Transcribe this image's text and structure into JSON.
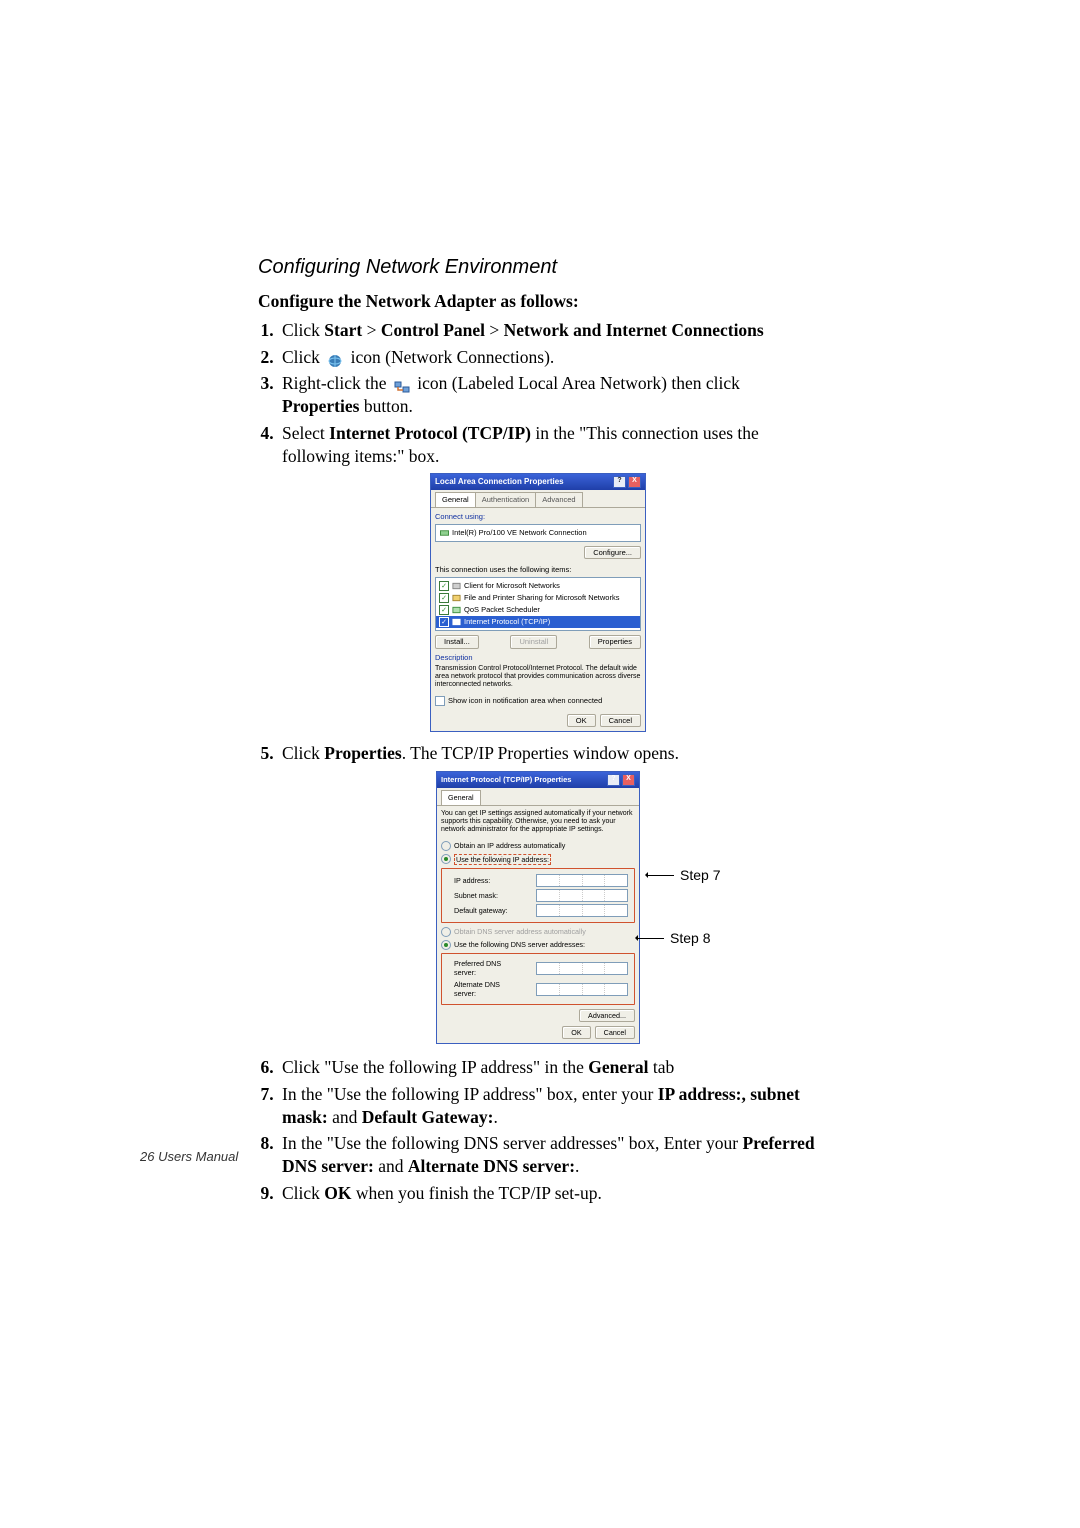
{
  "section_title": "Configuring Network Environment",
  "subtitle": "Configure the Network Adapter as follows:",
  "steps": {
    "s1a": "Click ",
    "s1b": "Start",
    "s1c": " > ",
    "s1d": "Control Panel",
    "s1e": " > ",
    "s1f": "Network and Internet Connections",
    "s2a": "Click ",
    "s2b": " icon (Network Connections).",
    "s3a": "Right-click the ",
    "s3b": " icon (Labeled Local Area Network) then click ",
    "s3c": "Properties",
    "s3d": " button.",
    "s4a": "Select ",
    "s4b": "Internet Protocol (TCP/IP)",
    "s4c": " in the \"This connection uses the following items:\" box.",
    "s5a": "Click ",
    "s5b": "Properties",
    "s5c": ". The TCP/IP Properties window opens.",
    "s6a": "Click \"Use the following IP address\" in the ",
    "s6b": "General",
    "s6c": " tab",
    "s7a": "In the \"Use the following IP address\" box, enter your ",
    "s7b": "IP address:, subnet mask:",
    "s7c": " and ",
    "s7d": "Default Gateway:",
    "s7e": ".",
    "s8a": "In the \"Use the following DNS server addresses\" box, Enter your ",
    "s8b": "Preferred DNS server:",
    "s8c": " and ",
    "s8d": "Alternate DNS server:",
    "s8e": ".",
    "s9a": "Click ",
    "s9b": "OK",
    "s9c": " when you finish the TCP/IP set-up."
  },
  "dialog1": {
    "title": "Local Area Connection Properties",
    "help": "?",
    "close": "X",
    "tabs": {
      "general": "General",
      "auth": "Authentication",
      "adv": "Advanced"
    },
    "connect_using": "Connect using:",
    "adapter": "Intel(R) Pro/100 VE Network Connection",
    "configure": "Configure...",
    "items_label": "This connection uses the following items:",
    "items": [
      "Client for Microsoft Networks",
      "File and Printer Sharing for Microsoft Networks",
      "QoS Packet Scheduler",
      "Internet Protocol (TCP/IP)"
    ],
    "install": "Install...",
    "uninstall": "Uninstall",
    "properties": "Properties",
    "desc_label": "Description",
    "desc": "Transmission Control Protocol/Internet Protocol. The default wide area network protocol that provides communication across diverse interconnected networks.",
    "show_icon": "Show icon in notification area when connected",
    "ok": "OK",
    "cancel": "Cancel"
  },
  "dialog2": {
    "title": "Internet Protocol (TCP/IP) Properties",
    "help": "?",
    "close": "X",
    "tab": "General",
    "help_text": "You can get IP settings assigned automatically if your network supports this capability. Otherwise, you need to ask your network administrator for the appropriate IP settings.",
    "r1": "Obtain an IP address automatically",
    "r2": "Use the following IP address:",
    "ip": "IP address:",
    "mask": "Subnet mask:",
    "gw": "Default gateway:",
    "r3": "Obtain DNS server address automatically",
    "r4": "Use the following DNS server addresses:",
    "dns1": "Preferred DNS server:",
    "dns2": "Alternate DNS server:",
    "advanced": "Advanced...",
    "ok": "OK",
    "cancel": "Cancel"
  },
  "callouts": {
    "step7": "Step 7",
    "step8": "Step 8"
  },
  "footer": "26  Users Manual"
}
